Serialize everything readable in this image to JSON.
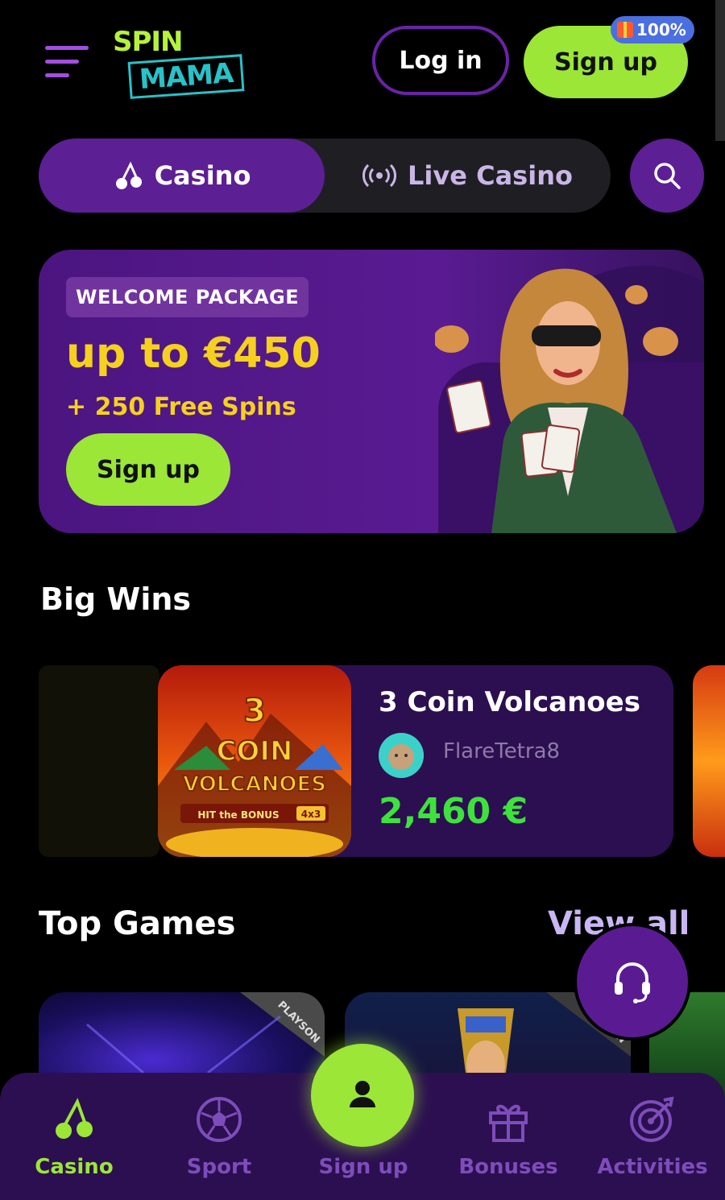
{
  "header": {
    "logo_top": "SPIN",
    "logo_bottom": "MAMA",
    "login_label": "Log in",
    "signup_label": "Sign up",
    "signup_badge": "100%"
  },
  "mode_tabs": {
    "casino_label": "Casino",
    "live_label": "Live Casino"
  },
  "hero": {
    "tag": "WELCOME PACKAGE",
    "amount": "up to €450",
    "spins": "+ 250 Free Spins",
    "cta": "Sign up"
  },
  "big_wins": {
    "title": "Big Wins",
    "card": {
      "game": "3 Coin Volcanoes",
      "user": "FlareTetra8",
      "amount": "2,460 €",
      "thumb_line1": "3",
      "thumb_line2": "COIN",
      "thumb_line3": "VOLCANOES",
      "thumb_line4": "HIT the BONUS",
      "thumb_badge": "4x3"
    }
  },
  "top_games": {
    "title": "Top Games",
    "view_all": "View all",
    "provider": "PLAYSON"
  },
  "bottom_nav": {
    "casino": "Casino",
    "sport": "Sport",
    "signup": "Sign up",
    "bonuses": "Bonuses",
    "activities": "Activities"
  },
  "colors": {
    "accent_green": "#9be637",
    "brand_purple": "#5d1f94",
    "win_green": "#3ee23c",
    "highlight_yellow": "#f5d11e"
  }
}
